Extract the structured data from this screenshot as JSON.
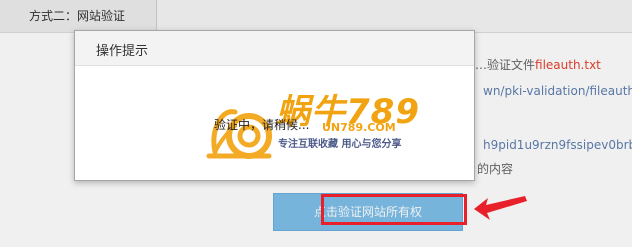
{
  "tab": {
    "label": "方式二：网站验证"
  },
  "background": {
    "file_line_prefix": "…验证文件",
    "file_name": "fileauth.txt",
    "url_fragment": "wn/pki-validation/fileauth.t",
    "hash_fragment": "h9pid1u9rzn9fssipev0brbw",
    "content_suffix": "的内容"
  },
  "dialog": {
    "title": "操作提示",
    "message": "验证中，请稍候..."
  },
  "verify_button": {
    "label": "点击验证网站所有权"
  },
  "watermark": {
    "brand": "蜗牛789",
    "url": "UN789.COM",
    "slogan": "专注互联收藏  用心与您分享"
  },
  "colors": {
    "highlight_border": "#e8202a",
    "button_bg": "#7ec0ea",
    "link_red": "#e8412e"
  }
}
